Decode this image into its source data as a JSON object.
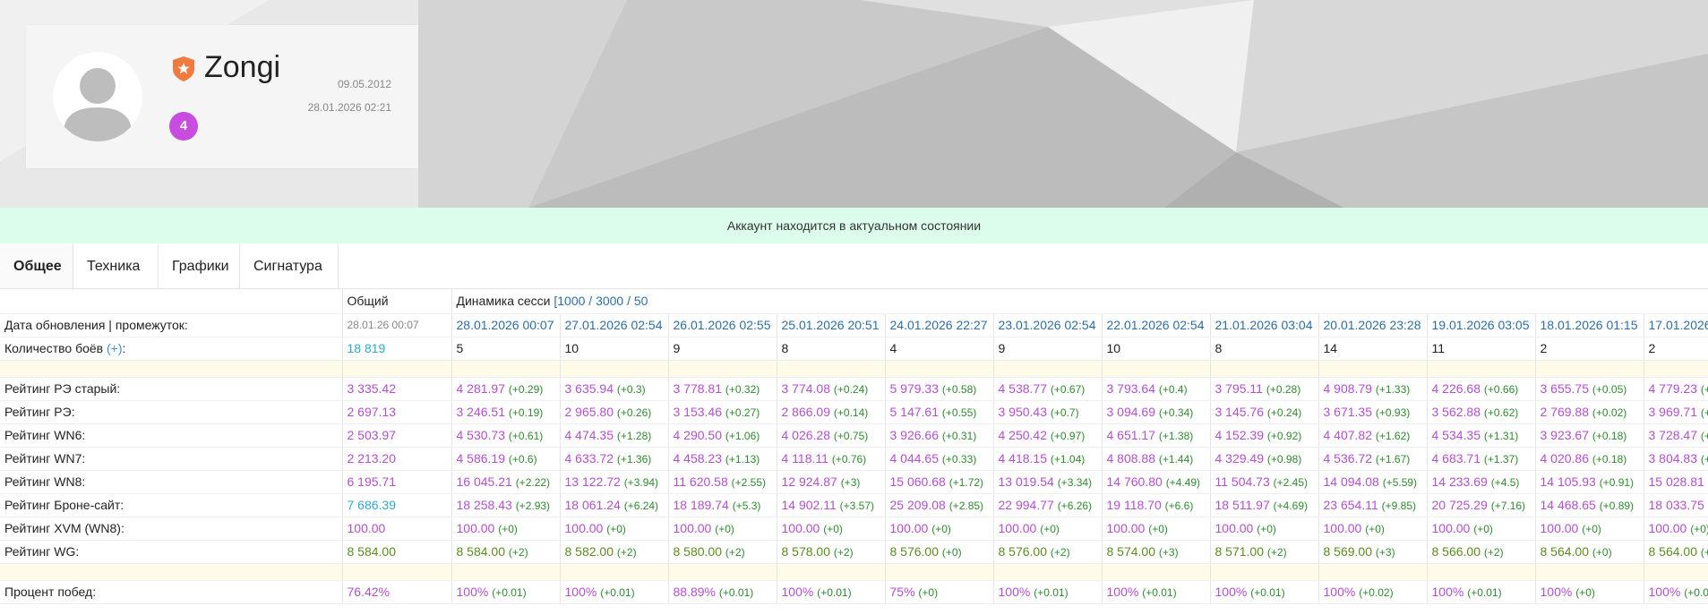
{
  "profile": {
    "username": "Zongi",
    "created_date": "09.05.2012",
    "updated_date": "28.01.2026 02:21",
    "level": "4"
  },
  "status_message": "Аккаунт находится в актуальном состоянии",
  "tabs": [
    {
      "label": "Общее",
      "active": true
    },
    {
      "label": "Техника",
      "active": false
    },
    {
      "label": "Графики",
      "active": false
    },
    {
      "label": "Сигнатура",
      "active": false
    }
  ],
  "table": {
    "header": {
      "overall": "Общий",
      "dynamics": "Динамика сесси",
      "ranges": "[1000 / 3000 / 50"
    },
    "date_row": {
      "label": "Дата обновления | промежуток:",
      "overall": "28.01.26 00:07",
      "sessions": [
        "28.01.2026 00:07",
        "27.01.2026 02:54",
        "26.01.2026 02:55",
        "25.01.2026 20:51",
        "24.01.2026 22:27",
        "23.01.2026 02:54",
        "22.01.2026 02:54",
        "21.01.2026 03:04",
        "20.01.2026 23:28",
        "19.01.2026 03:05",
        "18.01.2026 01:15",
        "17.01.2026 2"
      ]
    },
    "battles_row": {
      "label": "Количество боёв",
      "link": "(+)",
      "overall": "18 819",
      "sessions": [
        "5",
        "10",
        "9",
        "8",
        "4",
        "9",
        "10",
        "8",
        "14",
        "11",
        "2",
        "2"
      ]
    },
    "rating_rows": [
      {
        "label": "Рейтинг РЭ старый:",
        "overall": "3 335.42",
        "color": "purple",
        "sessions": [
          [
            "4 281.97",
            "(+0.29)"
          ],
          [
            "3 635.94",
            "(+0.3)"
          ],
          [
            "3 778.81",
            "(+0.32)"
          ],
          [
            "3 774.08",
            "(+0.24)"
          ],
          [
            "5 979.33",
            "(+0.58)"
          ],
          [
            "4 538.77",
            "(+0.67)"
          ],
          [
            "3 793.64",
            "(+0.4)"
          ],
          [
            "3 795.11",
            "(+0.28)"
          ],
          [
            "4 908.79",
            "(+1.33)"
          ],
          [
            "4 226.68",
            "(+0.66)"
          ],
          [
            "3 655.75",
            "(+0.05)"
          ],
          [
            "4 779.23",
            "(+0"
          ]
        ]
      },
      {
        "label": "Рейтинг РЭ:",
        "overall": "2 697.13",
        "color": "purple",
        "sessions": [
          [
            "3 246.51",
            "(+0.19)"
          ],
          [
            "2 965.80",
            "(+0.26)"
          ],
          [
            "3 153.46",
            "(+0.27)"
          ],
          [
            "2 866.09",
            "(+0.14)"
          ],
          [
            "5 147.61",
            "(+0.55)"
          ],
          [
            "3 950.43",
            "(+0.7)"
          ],
          [
            "3 094.69",
            "(+0.34)"
          ],
          [
            "3 145.76",
            "(+0.24)"
          ],
          [
            "3 671.35",
            "(+0.93)"
          ],
          [
            "3 562.88",
            "(+0.62)"
          ],
          [
            "2 769.88",
            "(+0.02)"
          ],
          [
            "3 969.71",
            "(+0"
          ]
        ]
      },
      {
        "label": "Рейтинг WN6:",
        "overall": "2 503.97",
        "color": "purple",
        "sessions": [
          [
            "4 530.73",
            "(+0.61)"
          ],
          [
            "4 474.35",
            "(+1.28)"
          ],
          [
            "4 290.50",
            "(+1.06)"
          ],
          [
            "4 026.28",
            "(+0.75)"
          ],
          [
            "3 926.66",
            "(+0.31)"
          ],
          [
            "4 250.42",
            "(+0.97)"
          ],
          [
            "4 651.17",
            "(+1.38)"
          ],
          [
            "4 152.39",
            "(+0.92)"
          ],
          [
            "4 407.82",
            "(+1.62)"
          ],
          [
            "4 534.35",
            "(+1.31)"
          ],
          [
            "3 923.67",
            "(+0.18)"
          ],
          [
            "3 728.47",
            "(+0"
          ]
        ]
      },
      {
        "label": "Рейтинг WN7:",
        "overall": "2 213.20",
        "color": "purple",
        "sessions": [
          [
            "4 586.19",
            "(+0.6)"
          ],
          [
            "4 633.72",
            "(+1.36)"
          ],
          [
            "4 458.23",
            "(+1.13)"
          ],
          [
            "4 118.11",
            "(+0.76)"
          ],
          [
            "4 044.65",
            "(+0.33)"
          ],
          [
            "4 418.15",
            "(+1.04)"
          ],
          [
            "4 808.88",
            "(+1.44)"
          ],
          [
            "4 329.49",
            "(+0.98)"
          ],
          [
            "4 536.72",
            "(+1.67)"
          ],
          [
            "4 683.71",
            "(+1.37)"
          ],
          [
            "4 020.86",
            "(+0.18)"
          ],
          [
            "3 804.83",
            "(+0"
          ]
        ]
      },
      {
        "label": "Рейтинг WN8:",
        "overall": "6 195.71",
        "color": "purple",
        "sessions": [
          [
            "16 045.21",
            "(+2.22)"
          ],
          [
            "13 122.72",
            "(+3.94)"
          ],
          [
            "11 620.58",
            "(+2.55)"
          ],
          [
            "12 924.87",
            "(+3)"
          ],
          [
            "15 060.68",
            "(+1.72)"
          ],
          [
            "13 019.54",
            "(+3.34)"
          ],
          [
            "14 760.80",
            "(+4.49)"
          ],
          [
            "11 504.73",
            "(+2.45)"
          ],
          [
            "14 094.08",
            "(+5.59)"
          ],
          [
            "14 233.69",
            "(+4.5)"
          ],
          [
            "14 105.93",
            "(+0.91)"
          ],
          [
            "15 028.81",
            "(+"
          ]
        ]
      },
      {
        "label": "Рейтинг Броне-сайт:",
        "overall": "7 686.39",
        "color": "teal",
        "session_color": "purple",
        "sessions": [
          [
            "18 258.43",
            "(+2.93)"
          ],
          [
            "18 061.24",
            "(+6.24)"
          ],
          [
            "18 189.74",
            "(+5.3)"
          ],
          [
            "14 902.11",
            "(+3.57)"
          ],
          [
            "25 209.08",
            "(+2.85)"
          ],
          [
            "22 994.77",
            "(+6.26)"
          ],
          [
            "19 118.70",
            "(+6.6)"
          ],
          [
            "18 511.97",
            "(+4.69)"
          ],
          [
            "23 654.11",
            "(+9.85)"
          ],
          [
            "20 725.29",
            "(+7.16)"
          ],
          [
            "14 468.65",
            "(+0.89)"
          ],
          [
            "18 033.75",
            "(+"
          ]
        ]
      },
      {
        "label": "Рейтинг XVM (WN8):",
        "overall": "100.00",
        "color": "purple",
        "sessions": [
          [
            "100.00",
            "(+0)"
          ],
          [
            "100.00",
            "(+0)"
          ],
          [
            "100.00",
            "(+0)"
          ],
          [
            "100.00",
            "(+0)"
          ],
          [
            "100.00",
            "(+0)"
          ],
          [
            "100.00",
            "(+0)"
          ],
          [
            "100.00",
            "(+0)"
          ],
          [
            "100.00",
            "(+0)"
          ],
          [
            "100.00",
            "(+0)"
          ],
          [
            "100.00",
            "(+0)"
          ],
          [
            "100.00",
            "(+0)"
          ],
          [
            "100.00",
            "(+0)"
          ]
        ]
      },
      {
        "label": "Рейтинг WG:",
        "overall": "8 584.00",
        "color": "green",
        "sessions": [
          [
            "8 584.00",
            "(+2)"
          ],
          [
            "8 582.00",
            "(+2)"
          ],
          [
            "8 580.00",
            "(+2)"
          ],
          [
            "8 578.00",
            "(+2)"
          ],
          [
            "8 576.00",
            "(+0)"
          ],
          [
            "8 576.00",
            "(+2)"
          ],
          [
            "8 574.00",
            "(+3)"
          ],
          [
            "8 571.00",
            "(+2)"
          ],
          [
            "8 569.00",
            "(+3)"
          ],
          [
            "8 566.00",
            "(+2)"
          ],
          [
            "8 564.00",
            "(+0)"
          ],
          [
            "8 564.00",
            "(+0)"
          ]
        ]
      }
    ],
    "winrate_row": {
      "label": "Процент побед:",
      "overall": "76.42%",
      "color": "purple",
      "sessions": [
        [
          "100%",
          "(+0.01)"
        ],
        [
          "100%",
          "(+0.01)"
        ],
        [
          "88.89%",
          "(+0.01)"
        ],
        [
          "100%",
          "(+0.01)"
        ],
        [
          "75%",
          "(+0)"
        ],
        [
          "100%",
          "(+0.01)"
        ],
        [
          "100%",
          "(+0.01)"
        ],
        [
          "100%",
          "(+0.01)"
        ],
        [
          "100%",
          "(+0.02)"
        ],
        [
          "100%",
          "(+0.01)"
        ],
        [
          "100%",
          "(+0)"
        ],
        [
          "100%",
          "(+0.0"
        ]
      ]
    }
  },
  "colors": {
    "purple": "#b34fd0",
    "green": "#5a8d1e",
    "teal": "#31a8c9",
    "status_bg": "#dcfcec",
    "level_badge": "#c84ce0",
    "rank_badge": "#f07b3f"
  }
}
